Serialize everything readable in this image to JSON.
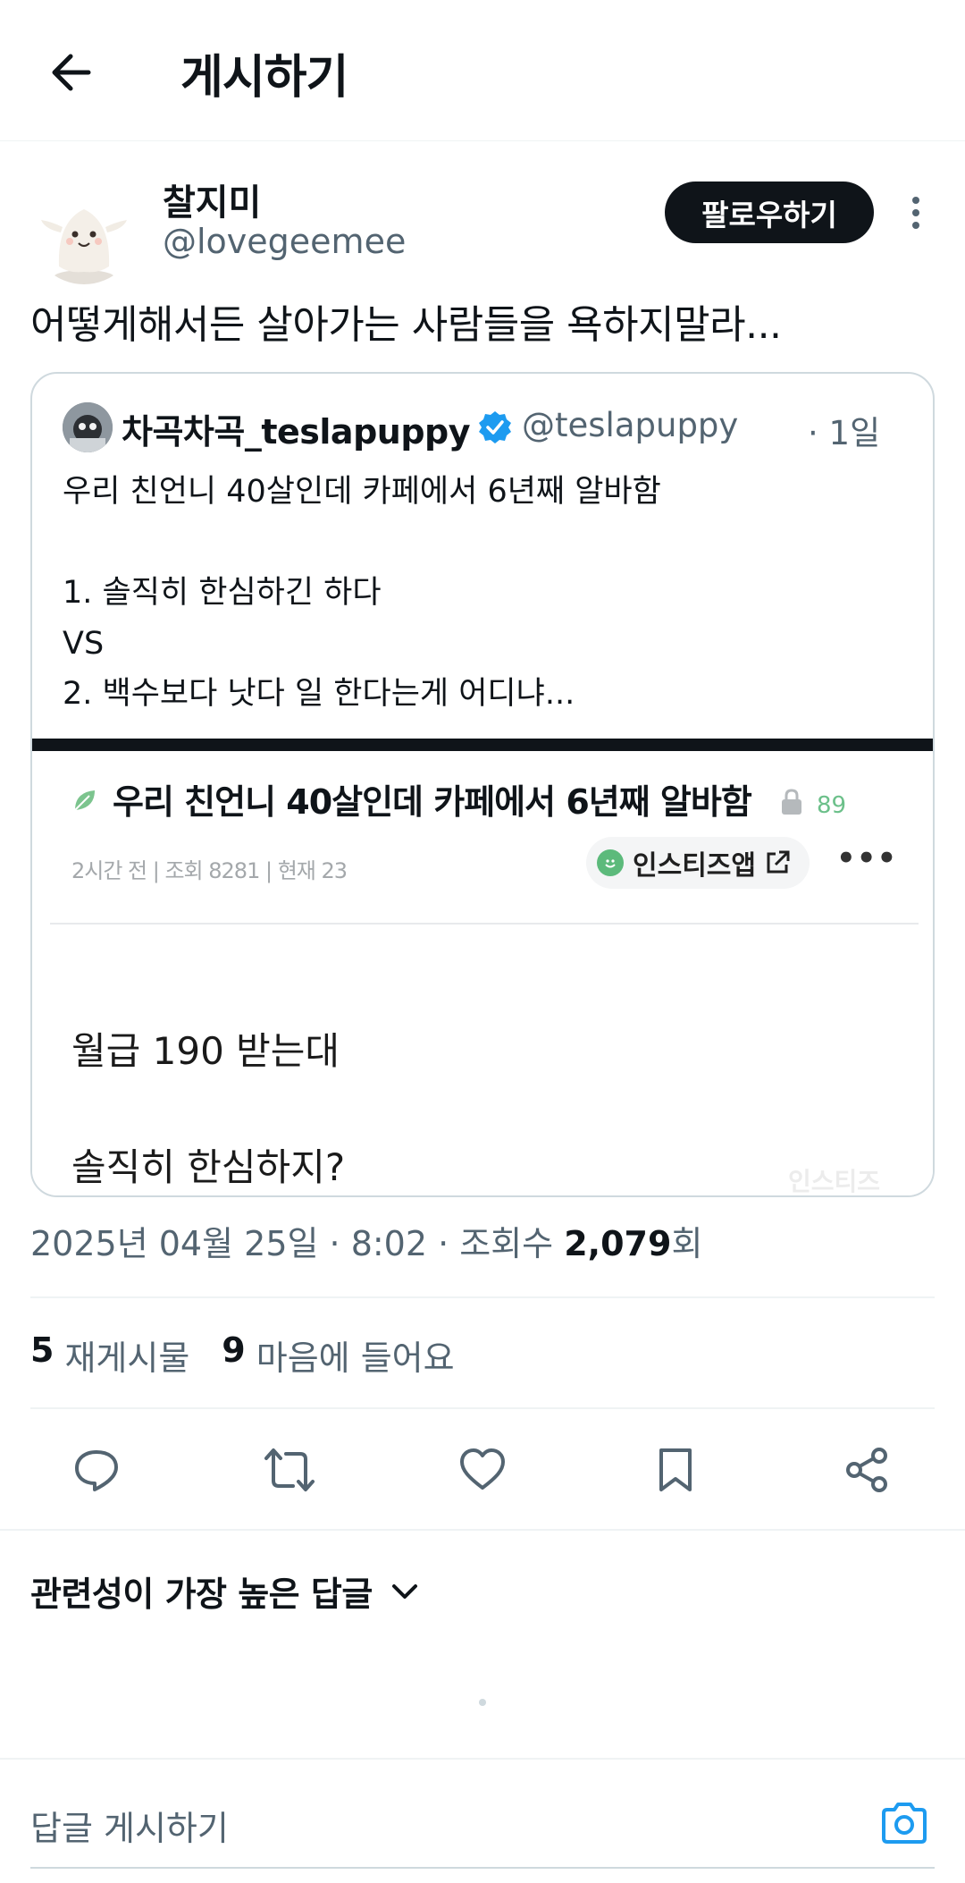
{
  "header": {
    "title": "게시하기",
    "back_icon": "arrow-left-icon"
  },
  "post": {
    "display_name": "찰지미",
    "handle": "@lovegeemee",
    "follow_label": "팔로우하기",
    "text": "어떻게해서든 살아가는 사람들을 욕하지말라...",
    "timestamp_prefix": "2025년 04월 25일 · 8:02 · 조회수 ",
    "views": "2,079",
    "views_suffix": "회"
  },
  "quote": {
    "display_name": "차곡차곡_teslapuppy",
    "handle": "@teslapuppy",
    "time": "· 1일",
    "lines": [
      "우리 친언니 40살인데 카페에서 6년째 알바함",
      "",
      "1. 솔직히 한심하긴 하다",
      "VS",
      "2. 백수보다 낫다 일 한다는게 어디냐..."
    ],
    "image": {
      "title": "우리 친언니 40살인데 카페에서 6년째 알바함",
      "comment_count": "89",
      "meta": "2시간 전  |  조회 8281  |  현재 23",
      "app_label": "인스티즈앱",
      "dots": "•••",
      "line1": "월급 190 받는대",
      "line2": "솔직히 한심하지?",
      "watermark": "인스티즈"
    }
  },
  "stats": {
    "reposts_count": "5",
    "reposts_label": "재게시물",
    "likes_count": "9",
    "likes_label": "마음에 들어요"
  },
  "actions": [
    "reply-icon",
    "repost-icon",
    "like-icon",
    "bookmark-icon",
    "share-icon"
  ],
  "replies": {
    "sort_label": "관련성이 가장 높은 답글",
    "placeholder": "답글 게시하기"
  },
  "colors": {
    "text": "#0f1419",
    "secondary": "#536471",
    "accent": "#1d9bf0",
    "divider": "#eff3f4"
  }
}
